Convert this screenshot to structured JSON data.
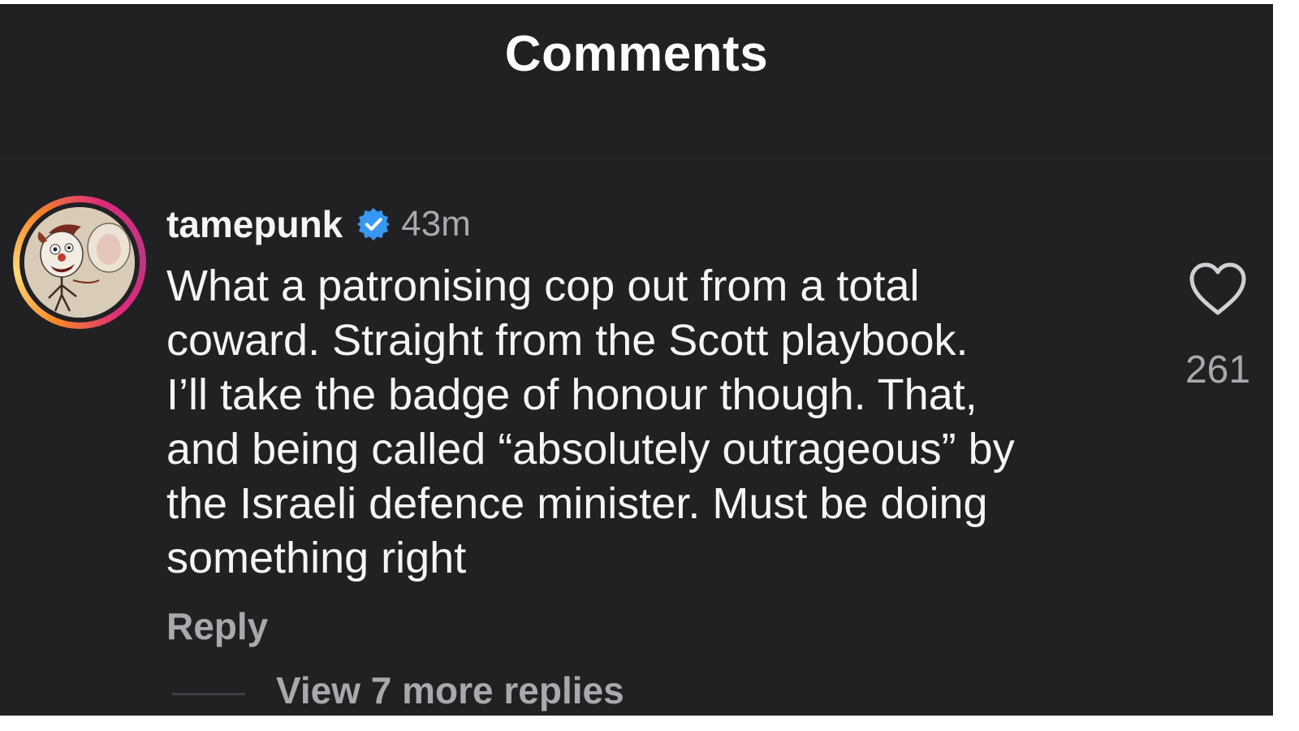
{
  "header": {
    "title": "Comments"
  },
  "comment": {
    "username": "tamepunk",
    "verified_icon": "verified-badge-icon",
    "timestamp": "43m",
    "text": "What a patronising cop out from a total\ncoward. Straight from the Scott playbook.\nI’ll take the badge of honour though. That,\nand being called “absolutely outrageous” by\nthe Israeli defence minister. Must be doing\nsomething right",
    "reply_label": "Reply",
    "view_replies_label": "View 7 more replies",
    "like_icon": "heart-outline-icon",
    "like_count": "261"
  },
  "colors": {
    "background": "#212124",
    "primary_text": "#f5f5f5",
    "secondary_text": "#a8a8ad",
    "verified_blue": "#3897f0"
  }
}
